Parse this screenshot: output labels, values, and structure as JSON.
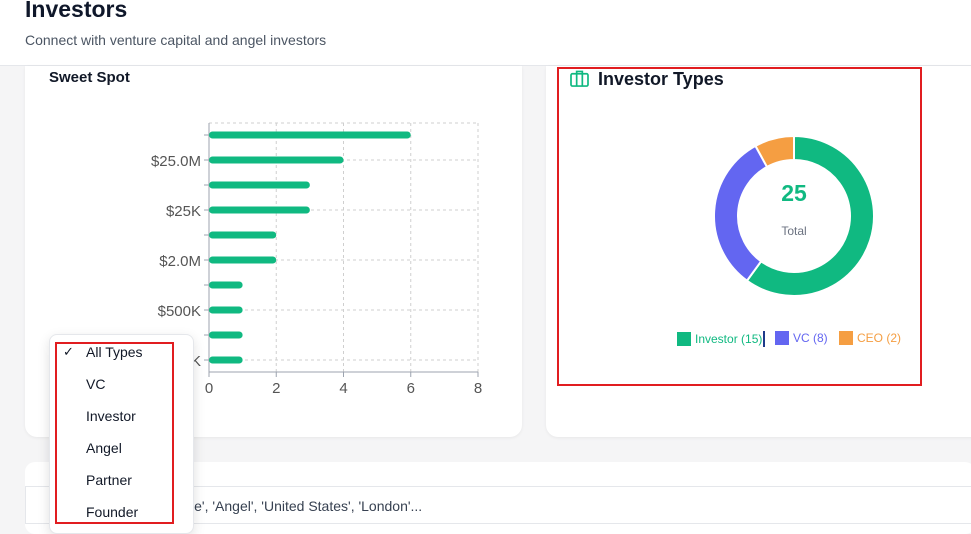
{
  "header": {
    "title": "Investors",
    "subtitle": "Connect with venture capital and angel investors"
  },
  "sweet_spot": {
    "title": "Sweet Spot"
  },
  "chart_data": {
    "type": "bar",
    "orientation": "horizontal",
    "title": "Sweet Spot",
    "categories": [
      "",
      "$25.0M",
      "",
      "$25K",
      "",
      "$2.0M",
      "",
      "$500K",
      "",
      "K"
    ],
    "values": [
      6,
      4,
      3,
      3,
      2,
      2,
      1,
      1,
      1,
      1
    ],
    "xlim": [
      0,
      8
    ],
    "xticks": [
      0,
      2,
      4,
      6,
      8
    ],
    "grid": true,
    "color": "#10b981"
  },
  "investor_types": {
    "title": "Investor Types",
    "total_value": "25",
    "total_label": "Total",
    "slices": [
      {
        "label": "Investor (15)",
        "value": 15,
        "color": "#10b981"
      },
      {
        "label": "VC (8)",
        "value": 8,
        "color": "#6366f1"
      },
      {
        "label": "CEO (2)",
        "value": 2,
        "color": "#f59e42"
      }
    ]
  },
  "filter_dropdown": {
    "options": [
      "All Types",
      "VC",
      "Investor",
      "Angel",
      "Partner",
      "Founder"
    ],
    "selected": "All Types"
  },
  "search": {
    "text": "nture', 'Angel', 'United States', 'London'..."
  },
  "colors": {
    "accent": "#10b981",
    "highlight": "#e11d20"
  }
}
